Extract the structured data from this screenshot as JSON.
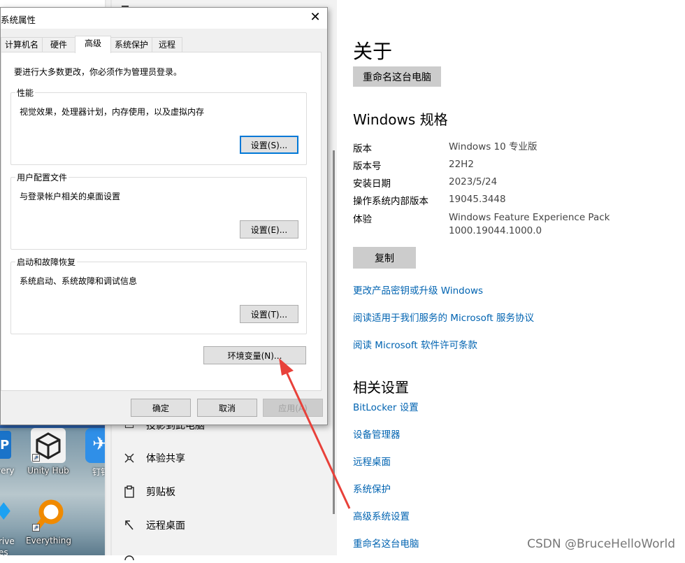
{
  "dialog": {
    "title": "系统属性",
    "close_glyph": "✕",
    "tabs": [
      "计算机名",
      "硬件",
      "高级",
      "系统保护",
      "远程"
    ],
    "active_tab": "高级",
    "notice": "要进行大多数更改，你必须作为管理员登录。",
    "performance": {
      "title": "性能",
      "desc": "视觉效果，处理器计划，内存使用，以及虚拟内存",
      "button": "设置(S)..."
    },
    "profiles": {
      "title": "用户配置文件",
      "desc": "与登录帐户相关的桌面设置",
      "button": "设置(E)..."
    },
    "startup": {
      "title": "启动和故障恢复",
      "desc": "系统启动、系统故障和调试信息",
      "button": "设置(T)..."
    },
    "env_button": "环境变量(N)...",
    "ok": "确定",
    "cancel": "取消",
    "apply": "应用(A)"
  },
  "about": {
    "title": "关于",
    "rename_button": "重命名这台电脑",
    "specs_title": "Windows 规格",
    "specs": [
      {
        "key": "版本",
        "value": "Windows 10 专业版"
      },
      {
        "key": "版本号",
        "value": "22H2"
      },
      {
        "key": "安装日期",
        "value": "2023/5/24"
      },
      {
        "key": "操作系统内部版本",
        "value": "19045.3448"
      },
      {
        "key": "体验",
        "value": "Windows Feature Experience Pack",
        "value2": "1000.19044.1000.0"
      }
    ],
    "copy_button": "复制",
    "links": [
      "更改产品密钥或升级 Windows",
      "阅读适用于我们服务的 Microsoft 服务协议",
      "阅读 Microsoft 软件许可条款"
    ],
    "related_title": "相关设置",
    "related_links": [
      "BitLocker 设置",
      "设备管理器",
      "远程桌面",
      "系统保护",
      "高级系统设置",
      "重命名这台电脑"
    ]
  },
  "nav": {
    "items": [
      {
        "label": "投影到此电脑",
        "icon": "projector-icon",
        "glyph": "▭"
      },
      {
        "label": "体验共享",
        "icon": "shared-experiences-icon",
        "glyph": "⚲"
      },
      {
        "label": "剪贴板",
        "icon": "clipboard-icon",
        "glyph": "📋"
      },
      {
        "label": "远程桌面",
        "icon": "remote-desktop-icon",
        "glyph": "✕"
      }
    ]
  },
  "desktop": {
    "icons": [
      {
        "label": "Unity Hub",
        "icon": "unity-hub-icon"
      },
      {
        "label": "Everything",
        "icon": "everything-search-icon"
      }
    ],
    "partial_labels": [
      "very",
      "rive",
      "es",
      "钉钉"
    ]
  },
  "watermark": "CSDN @BruceHelloWorld",
  "colors": {
    "link": "#0063b1",
    "accent": "#0078d7",
    "arrow": "#e8413a"
  }
}
